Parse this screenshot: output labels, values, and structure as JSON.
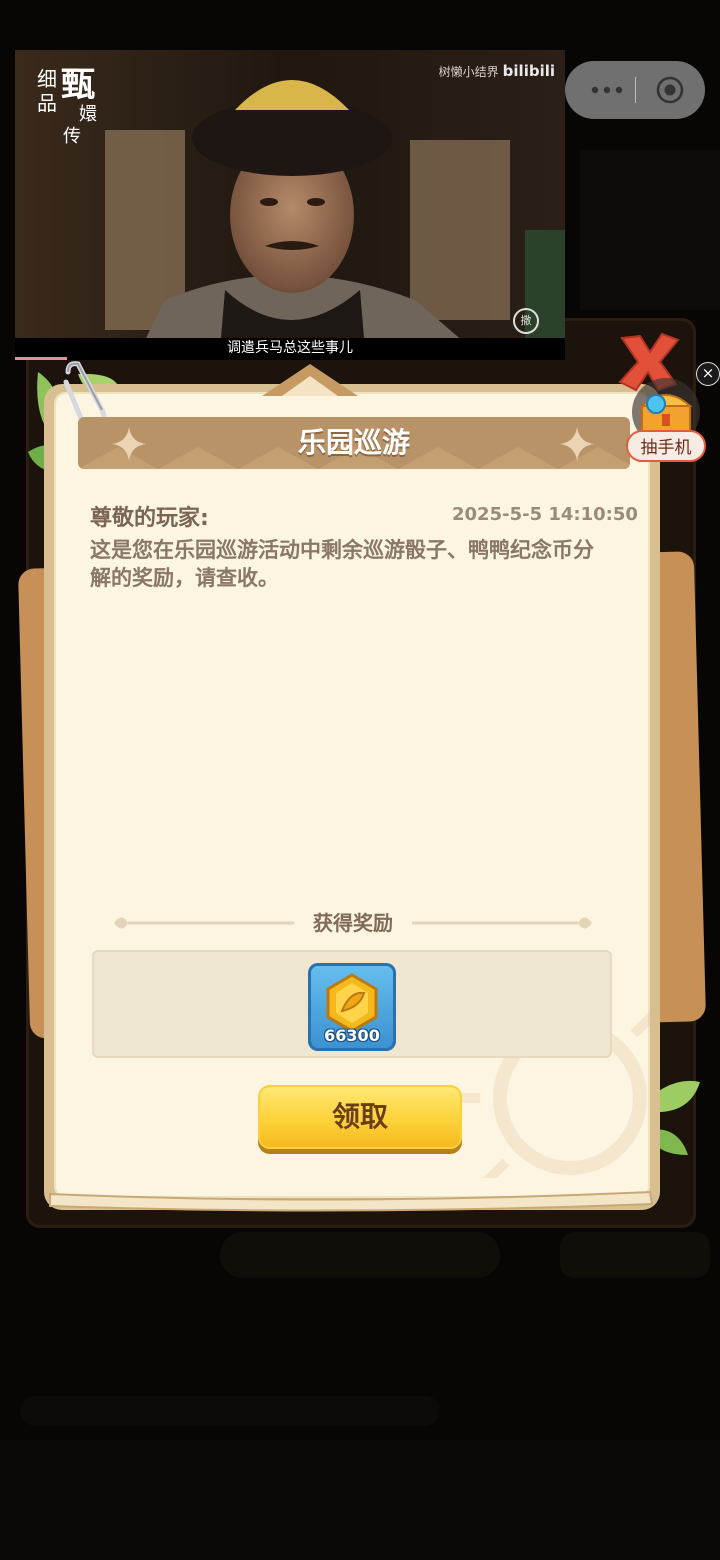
{
  "video": {
    "watermark_left": "细品甄嬛传",
    "watermark_right_user": "树懒小结界",
    "watermark_right_brand": "bilibili",
    "subtitle": "调遣兵马总这些事儿",
    "stamp": "撒"
  },
  "capsule": {
    "more_icon": "more-icon",
    "close_icon": "target-icon"
  },
  "sidebar_gift": {
    "label": "抽手机",
    "close_glyph": "×"
  },
  "mail": {
    "title": "乐园巡游",
    "greeting": "尊敬的玩家:",
    "datetime": "2025-5-5 14:10:50",
    "body": "这是您在乐园巡游活动中剩余巡游骰子、鸭鸭纪念币分解的奖励，请查收。",
    "reward_header": "获得奖励",
    "rewards": [
      {
        "icon": "gold-coin-icon",
        "quantity": "66300"
      }
    ],
    "claim_label": "领取"
  },
  "colors": {
    "panel_bg": "#fcf5e1",
    "header_bg": "#b99368",
    "button_yellow": "#fdd23a",
    "reward_tile_blue": "#3b8fd0",
    "close_red": "#e2503a"
  }
}
